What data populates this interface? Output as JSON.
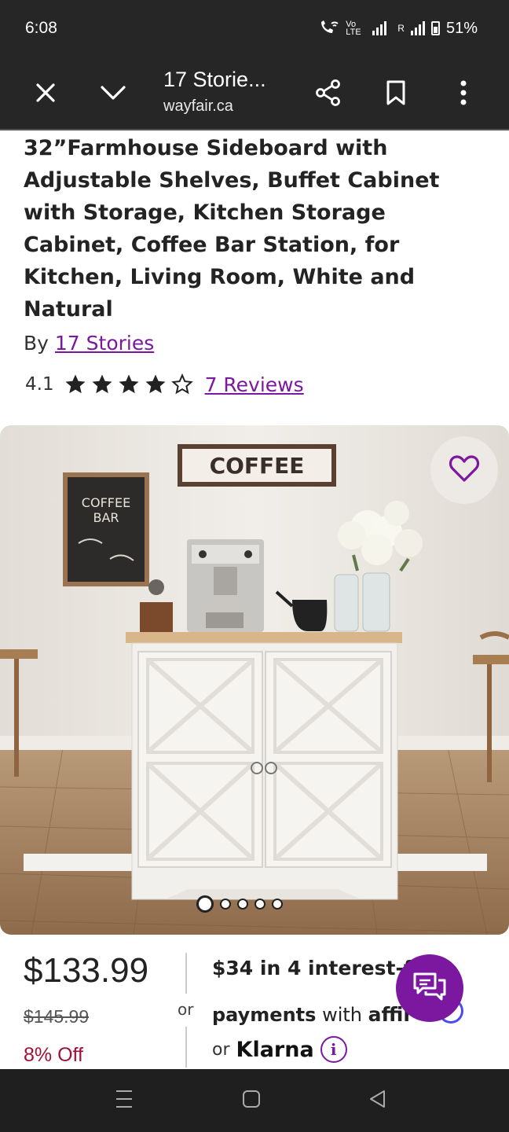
{
  "status_bar": {
    "time": "6:08",
    "network_1": "Vo LTE",
    "network_2": "R",
    "battery": "51%"
  },
  "browser": {
    "tab_title": "17 Storie...",
    "url": "wayfair.ca",
    "icons": [
      "close-icon",
      "chevron-down-icon",
      "share-icon",
      "bookmark-icon",
      "more-vert-icon"
    ]
  },
  "product": {
    "title": "32”Farmhouse Sideboard with Adjustable Shelves, Buffet Cabinet with Storage, Kitchen Storage Cabinet, Coffee Bar Station, for Kitchen, Living Room, White and Natural",
    "by_prefix": "By",
    "brand": "17 Stories",
    "rating": "4.1",
    "rating_value": 4.1,
    "reviews": "7 Reviews"
  },
  "gallery": {
    "image_count": 5,
    "active_index": 0,
    "sign_text": "COFFEE",
    "chalkboard_text": "COFFEE BAR"
  },
  "pricing": {
    "price": "$133.99",
    "old_price": "$145.99",
    "discount": "8% Off",
    "or_label": "or",
    "installment": "$34 in 4 interest-f",
    "payments_label": "payments",
    "with_label": "with",
    "affirm_label": "affir",
    "klarna_prefix": "or",
    "klarna_label": "Klarna",
    "info_glyph": "i"
  },
  "colors": {
    "accent_purple": "#7b189f",
    "discount_red": "#a2103a",
    "bar_dark": "#262626"
  }
}
